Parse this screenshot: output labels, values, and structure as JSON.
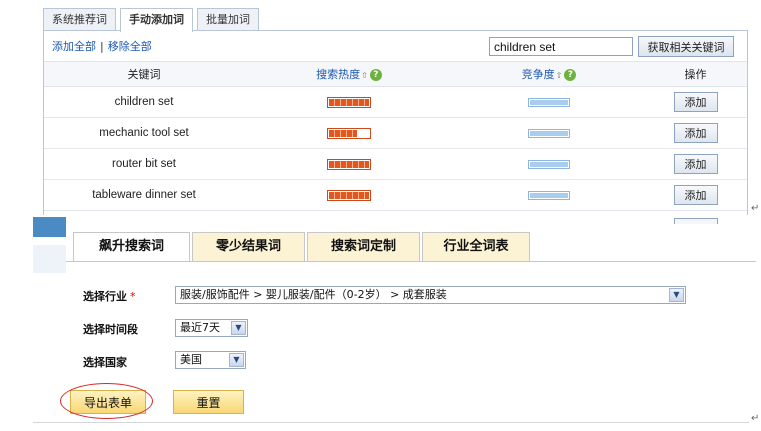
{
  "top": {
    "tabs": [
      {
        "label": "系统推荐词",
        "active": false
      },
      {
        "label": "手动添加词",
        "active": true
      },
      {
        "label": "批量加词",
        "active": false
      }
    ],
    "add_all": "添加全部",
    "separator": "|",
    "remove_all": "移除全部",
    "search_value": "children set",
    "fetch_button": "获取相关关键词",
    "columns": {
      "keyword": "关键词",
      "heat": "搜索热度",
      "competition": "竞争度",
      "action": "操作"
    },
    "sort_icon": "sort-arrow-icon",
    "help_icon": "help-icon",
    "help_glyph": "?",
    "rows": [
      {
        "keyword": "children set",
        "heat": 1.0,
        "competition": 1.0,
        "action": "添加"
      },
      {
        "keyword": "mechanic tool set",
        "heat": 0.7,
        "competition": 1.0,
        "action": "添加"
      },
      {
        "keyword": "router bit set",
        "heat": 1.0,
        "competition": 1.0,
        "action": "添加"
      },
      {
        "keyword": "tableware dinner set",
        "heat": 1.0,
        "competition": 1.0,
        "action": "添加"
      }
    ]
  },
  "bottom": {
    "tabs": [
      {
        "label": "飙升搜索词",
        "active": true
      },
      {
        "label": "零少结果词",
        "active": false
      },
      {
        "label": "搜索词定制",
        "active": false
      },
      {
        "label": "行业全词表",
        "active": false
      }
    ],
    "industry_label": "选择行业",
    "required_mark": "*",
    "industry_value": "服装/服饰配件 > 婴儿服装/配件（0-2岁） > 成套服装",
    "period_label": "选择时间段",
    "period_value": "最近7天",
    "country_label": "选择国家",
    "country_value": "美国",
    "export_button": "导出表单",
    "reset_button": "重置"
  },
  "colors": {
    "heat": "#e2571e",
    "competition": "#a9cdef",
    "highlight_ring": "#d62a2a"
  },
  "paragraph_mark": "↵"
}
